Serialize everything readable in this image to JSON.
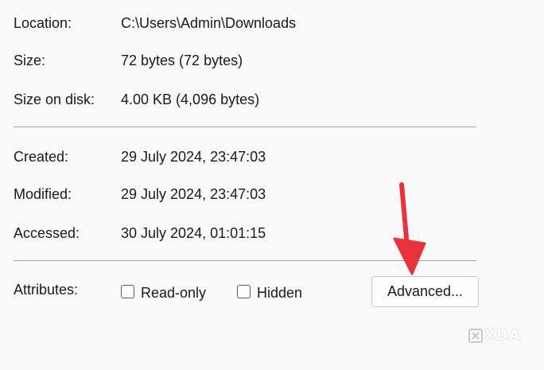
{
  "general": {
    "location": {
      "label": "Location:",
      "value": "C:\\Users\\Admin\\Downloads"
    },
    "size": {
      "label": "Size:",
      "value": "72 bytes (72 bytes)"
    },
    "size_on_disk": {
      "label": "Size on disk:",
      "value": "4.00 KB (4,096 bytes)"
    }
  },
  "dates": {
    "created": {
      "label": "Created:",
      "value": "29 July 2024, 23:47:03"
    },
    "modified": {
      "label": "Modified:",
      "value": "29 July 2024, 23:47:03"
    },
    "accessed": {
      "label": "Accessed:",
      "value": "30 July 2024, 01:01:15"
    }
  },
  "attributes": {
    "label": "Attributes:",
    "read_only": {
      "label": "Read-only",
      "checked": false
    },
    "hidden": {
      "label": "Hidden",
      "checked": false
    },
    "advanced_button": "Advanced..."
  },
  "annotation": {
    "arrow_color": "#e8323c",
    "icon": "arrow-down-icon"
  },
  "watermark": {
    "text": "XDA"
  }
}
